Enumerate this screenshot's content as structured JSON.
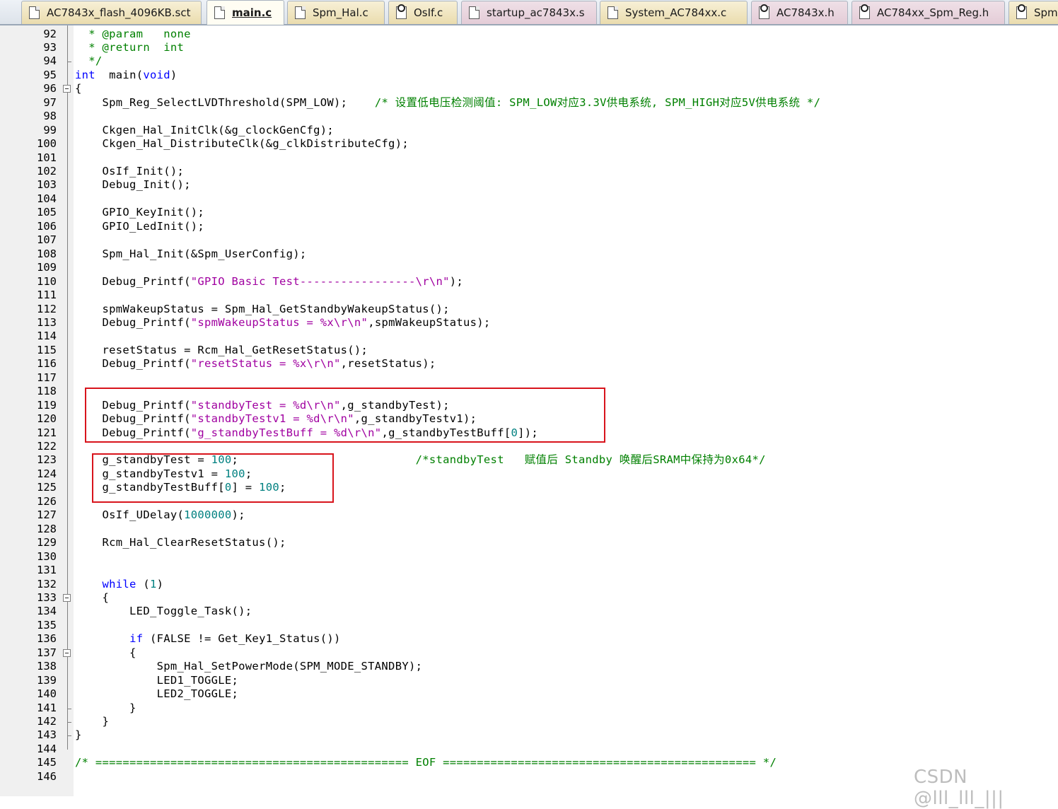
{
  "tabs": [
    {
      "label": "AC7843x_flash_4096KB.sct",
      "icon": "document-icon",
      "kind": "sct"
    },
    {
      "label": "main.c",
      "icon": "document-icon",
      "kind": "c",
      "active": true
    },
    {
      "label": "Spm_Hal.c",
      "icon": "document-icon",
      "kind": "c"
    },
    {
      "label": "OsIf.c",
      "icon": "locked-document-icon",
      "kind": "c"
    },
    {
      "label": "startup_ac7843x.s",
      "icon": "document-icon",
      "kind": "h"
    },
    {
      "label": "System_AC784xx.c",
      "icon": "document-icon",
      "kind": "c"
    },
    {
      "label": "AC7843x.h",
      "icon": "locked-document-icon",
      "kind": "h"
    },
    {
      "label": "AC784xx_Spm_Reg.h",
      "icon": "locked-document-icon",
      "kind": "h"
    },
    {
      "label": "Spm",
      "icon": "locked-document-icon",
      "kind": "c"
    }
  ],
  "lines": [
    {
      "n": "92",
      "segs": [
        [
          "cm",
          "  * @param   none"
        ]
      ]
    },
    {
      "n": "93",
      "segs": [
        [
          "cm",
          "  * @return  int"
        ]
      ]
    },
    {
      "n": "94",
      "segs": [
        [
          "cm",
          "  */"
        ]
      ]
    },
    {
      "n": "95",
      "segs": [
        [
          "kw",
          "int"
        ],
        [
          "",
          "  main("
        ],
        [
          "kw",
          "void"
        ],
        [
          "",
          ")"
        ]
      ]
    },
    {
      "n": "96",
      "segs": [
        [
          "",
          "{"
        ]
      ]
    },
    {
      "n": "97",
      "segs": [
        [
          "",
          "    Spm_Reg_SelectLVDThreshold(SPM_LOW);    "
        ],
        [
          "cm",
          "/* 设置低电压检测阈值: SPM_LOW对应3.3V供电系统, SPM_HIGH对应5V供电系统 */"
        ]
      ]
    },
    {
      "n": "98",
      "segs": []
    },
    {
      "n": "99",
      "segs": [
        [
          "",
          "    Ckgen_Hal_InitClk(&g_clockGenCfg);"
        ]
      ]
    },
    {
      "n": "100",
      "segs": [
        [
          "",
          "    Ckgen_Hal_DistributeClk(&g_clkDistributeCfg);"
        ]
      ]
    },
    {
      "n": "101",
      "segs": []
    },
    {
      "n": "102",
      "segs": [
        [
          "",
          "    OsIf_Init();"
        ]
      ]
    },
    {
      "n": "103",
      "segs": [
        [
          "",
          "    Debug_Init();"
        ]
      ]
    },
    {
      "n": "104",
      "segs": []
    },
    {
      "n": "105",
      "segs": [
        [
          "",
          "    GPIO_KeyInit();"
        ]
      ]
    },
    {
      "n": "106",
      "segs": [
        [
          "",
          "    GPIO_LedInit();"
        ]
      ]
    },
    {
      "n": "107",
      "segs": []
    },
    {
      "n": "108",
      "segs": [
        [
          "",
          "    Spm_Hal_Init(&Spm_UserConfig);"
        ]
      ]
    },
    {
      "n": "109",
      "segs": []
    },
    {
      "n": "110",
      "segs": [
        [
          "",
          "    Debug_Printf("
        ],
        [
          "st",
          "\"GPIO Basic Test-----------------\\r\\n\""
        ],
        [
          "",
          ");"
        ]
      ]
    },
    {
      "n": "111",
      "segs": []
    },
    {
      "n": "112",
      "segs": [
        [
          "",
          "    spmWakeupStatus = Spm_Hal_GetStandbyWakeupStatus();"
        ]
      ]
    },
    {
      "n": "113",
      "segs": [
        [
          "",
          "    Debug_Printf("
        ],
        [
          "st",
          "\"spmWakeupStatus = %x\\r\\n\""
        ],
        [
          "",
          ",spmWakeupStatus);"
        ]
      ]
    },
    {
      "n": "114",
      "segs": []
    },
    {
      "n": "115",
      "segs": [
        [
          "",
          "    resetStatus = Rcm_Hal_GetResetStatus();"
        ]
      ]
    },
    {
      "n": "116",
      "segs": [
        [
          "",
          "    Debug_Printf("
        ],
        [
          "st",
          "\"resetStatus = %x\\r\\n\""
        ],
        [
          "",
          ",resetStatus);"
        ]
      ]
    },
    {
      "n": "117",
      "segs": []
    },
    {
      "n": "118",
      "segs": []
    },
    {
      "n": "119",
      "segs": [
        [
          "",
          "    Debug_Printf("
        ],
        [
          "st",
          "\"standbyTest = %d\\r\\n\""
        ],
        [
          "",
          ",g_standbyTest);"
        ]
      ]
    },
    {
      "n": "120",
      "segs": [
        [
          "",
          "    Debug_Printf("
        ],
        [
          "st",
          "\"standbyTestv1 = %d\\r\\n\""
        ],
        [
          "",
          ",g_standbyTestv1);"
        ]
      ]
    },
    {
      "n": "121",
      "segs": [
        [
          "",
          "    Debug_Printf("
        ],
        [
          "st",
          "\"g_standbyTestBuff = %d\\r\\n\""
        ],
        [
          "",
          ",g_standbyTestBuff["
        ],
        [
          "nm",
          "0"
        ],
        [
          "",
          "]);"
        ]
      ]
    },
    {
      "n": "122",
      "segs": []
    },
    {
      "n": "123",
      "segs": [
        [
          "",
          "    g_standbyTest = "
        ],
        [
          "nm",
          "100"
        ],
        [
          "",
          ";                          "
        ],
        [
          "cm",
          "/*standbyTest   赋值后 Standby 唤醒后SRAM中保持为0x64*/"
        ]
      ]
    },
    {
      "n": "124",
      "segs": [
        [
          "",
          "    g_standbyTestv1 = "
        ],
        [
          "nm",
          "100"
        ],
        [
          "",
          ";"
        ]
      ]
    },
    {
      "n": "125",
      "segs": [
        [
          "",
          "    g_standbyTestBuff["
        ],
        [
          "nm",
          "0"
        ],
        [
          "",
          "] = "
        ],
        [
          "nm",
          "100"
        ],
        [
          "",
          ";"
        ]
      ]
    },
    {
      "n": "126",
      "segs": []
    },
    {
      "n": "127",
      "segs": [
        [
          "",
          "    OsIf_UDelay("
        ],
        [
          "nm",
          "1000000"
        ],
        [
          "",
          ");"
        ]
      ]
    },
    {
      "n": "128",
      "segs": []
    },
    {
      "n": "129",
      "segs": [
        [
          "",
          "    Rcm_Hal_ClearResetStatus();"
        ]
      ]
    },
    {
      "n": "130",
      "segs": []
    },
    {
      "n": "131",
      "segs": []
    },
    {
      "n": "132",
      "segs": [
        [
          "",
          "    "
        ],
        [
          "kw",
          "while"
        ],
        [
          "",
          " ("
        ],
        [
          "nm",
          "1"
        ],
        [
          "",
          ")"
        ]
      ]
    },
    {
      "n": "133",
      "segs": [
        [
          "",
          "    {"
        ]
      ]
    },
    {
      "n": "134",
      "segs": [
        [
          "",
          "        LED_Toggle_Task();"
        ]
      ]
    },
    {
      "n": "135",
      "segs": []
    },
    {
      "n": "136",
      "segs": [
        [
          "",
          "        "
        ],
        [
          "kw",
          "if"
        ],
        [
          "",
          " (FALSE != Get_Key1_Status())"
        ]
      ]
    },
    {
      "n": "137",
      "segs": [
        [
          "",
          "        {"
        ]
      ]
    },
    {
      "n": "138",
      "segs": [
        [
          "",
          "            Spm_Hal_SetPowerMode(SPM_MODE_STANDBY);"
        ]
      ]
    },
    {
      "n": "139",
      "segs": [
        [
          "",
          "            LED1_TOGGLE;"
        ]
      ]
    },
    {
      "n": "140",
      "segs": [
        [
          "",
          "            LED2_TOGGLE;"
        ]
      ]
    },
    {
      "n": "141",
      "segs": [
        [
          "",
          "        }"
        ]
      ]
    },
    {
      "n": "142",
      "segs": [
        [
          "",
          "    }"
        ]
      ]
    },
    {
      "n": "143",
      "segs": [
        [
          "",
          "}"
        ]
      ]
    },
    {
      "n": "144",
      "segs": []
    },
    {
      "n": "145",
      "segs": [
        [
          "cm",
          "/* ============================================== EOF ============================================== */"
        ]
      ]
    },
    {
      "n": "146",
      "segs": []
    }
  ],
  "watermark": "CSDN @lll_lll_|||"
}
